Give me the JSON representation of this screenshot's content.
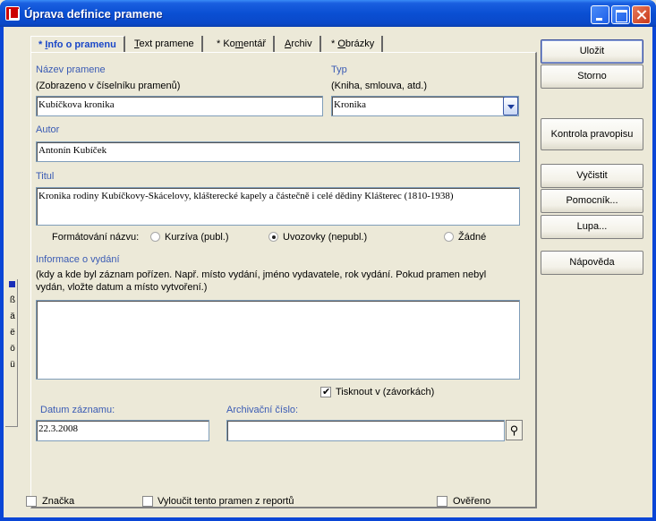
{
  "window": {
    "title": "Úprava definice pramene"
  },
  "tabs": [
    {
      "pre": "* ",
      "u": "I",
      "post": "nfo o pramenu"
    },
    {
      "pre": "",
      "u": "T",
      "post": "ext pramene"
    },
    {
      "pre": "* Ko",
      "u": "m",
      "post": "entář"
    },
    {
      "pre": "",
      "u": "A",
      "post": "rchiv"
    },
    {
      "pre": "* ",
      "u": "O",
      "post": "brázky"
    }
  ],
  "form": {
    "nazev_label": "Název pramene",
    "nazev_hint": "(Zobrazeno v číselníku pramenů)",
    "nazev_value": "Kubíčkova kronika",
    "typ_label": "Typ",
    "typ_hint": "(Kniha, smlouva, atd.)",
    "typ_value": "Kronika",
    "autor_label": "Autor",
    "autor_value": "Antonín Kubíček",
    "titul_label": "Titul",
    "titul_value": "Kronika rodiny Kubíčkovy-Skácelovy, klášterecké kapely a částečně i celé dědiny Klášterec (1810-1938)",
    "format_label": "Formátování názvu:",
    "format_options": [
      "Kurzíva (publ.)",
      "Uvozovky (nepubl.)",
      "Žádné"
    ],
    "format_selected": 1,
    "info_label": "Informace o vydání",
    "info_hint": "(kdy a kde byl záznam pořízen. Např. místo vydání, jméno vydavatele, rok vydání. Pokud pramen nebyl vydán, vložte datum a místo vytvoření.)",
    "info_value": "",
    "tisknout_label": "Tisknout v (závorkách)",
    "tisknout_checked": true,
    "datum_label": "Datum záznamu:",
    "datum_value": "22.3.2008",
    "archiv_label": "Archivační číslo:",
    "archiv_value": ""
  },
  "buttons": {
    "ulozit": "Uložit",
    "storno": "Storno",
    "kontrola": "Kontrola pravopisu",
    "vycistit": "Vyčistit",
    "pomocnik": "Pomocník...",
    "lupa": "Lupa...",
    "napoveda": "Nápověda"
  },
  "footer": {
    "znacka": "Značka",
    "vyloucit": "Vyloučit tento pramen z reportů",
    "overeno": "Ověřeno"
  },
  "charstrip": [
    "ß",
    "ä",
    "ë",
    "ö",
    "ü"
  ]
}
